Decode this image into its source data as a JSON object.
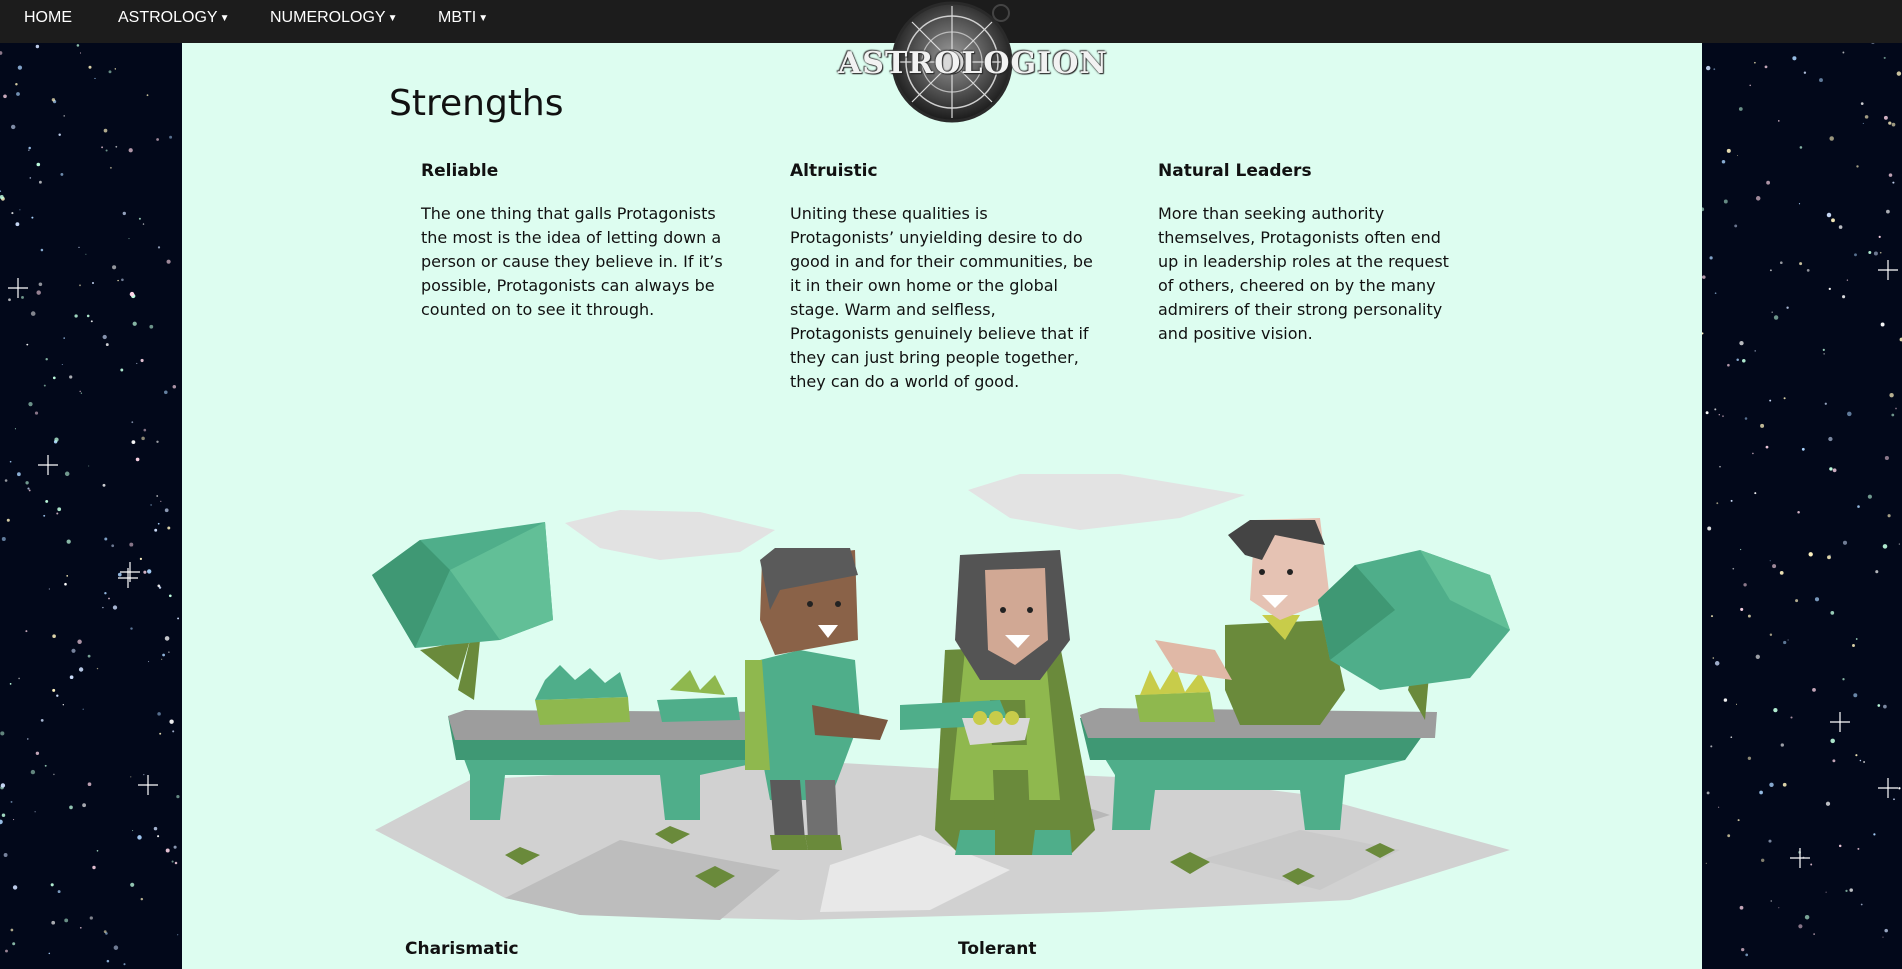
{
  "nav": {
    "home": "HOME",
    "astrology": "ASTROLOGY",
    "numerology": "NUMEROLOGY",
    "mbti": "MBTI"
  },
  "logo": {
    "text": "ASTROLOGION"
  },
  "section": {
    "title": "Strengths",
    "items": [
      {
        "title": "Reliable",
        "text": "The one thing that galls Protagonists the most is the idea of letting down a person or cause they believe in. If it’s possible, Protagonists can always be counted on to see it through."
      },
      {
        "title": "Altruistic",
        "text": "Uniting these qualities is Protagonists’ unyielding desire to do good in and for their communities, be it in their own home or the global stage. Warm and selfless, Protagonists genuinely believe that if they can just bring people together, they can do a world of good."
      },
      {
        "title": "Natural Leaders",
        "text": "More than seeking authority themselves, Protagonists often end up in leadership roles at the request of others, cheered on by the many admirers of their strong personality and positive vision."
      }
    ],
    "next_items": [
      "Charismatic",
      "Tolerant"
    ]
  },
  "colors": {
    "navbar": "#1c1c1c",
    "panel": "#ddfdf0",
    "space": "#02081a",
    "leaf": "#4fae8a",
    "table_top": "#9d9d9d"
  },
  "icons": [
    "caret-down-icon",
    "astrology-wheel-icon"
  ]
}
